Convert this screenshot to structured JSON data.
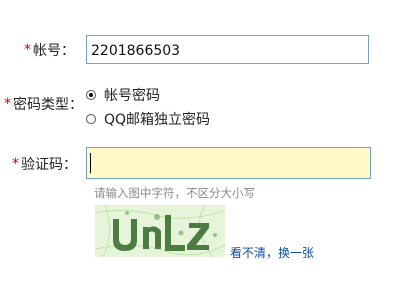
{
  "form": {
    "account": {
      "required_mark": "*",
      "label": "帐号：",
      "value": "2201866503"
    },
    "password_type": {
      "required_mark": "*",
      "label": "密码类型：",
      "options": [
        {
          "label": "帐号密码",
          "selected": true
        },
        {
          "label": "QQ邮箱独立密码",
          "selected": false
        }
      ]
    },
    "captcha": {
      "required_mark": "*",
      "label": "验证码：",
      "value": "",
      "hint": "请输入图中字符，不区分大小写",
      "refresh_link": "看不清，换一张"
    }
  },
  "colors": {
    "required": "#d40000",
    "input_border": "#6fa1c9",
    "captcha_input_bg": "#fff9c7",
    "link": "#0a4fa8",
    "hint": "#8a8a8a",
    "captcha_bg": "#e4f4d8"
  }
}
